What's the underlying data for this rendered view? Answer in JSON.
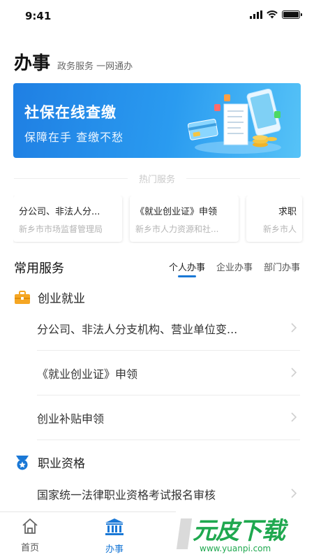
{
  "status_bar": {
    "time": "9:41"
  },
  "header": {
    "title": "办事",
    "subtitle": "政务服务 一网通办"
  },
  "banner": {
    "title": "社保在线查缴",
    "subtitle": "保障在手  查缴不愁"
  },
  "hot_services": {
    "heading": "热门服务",
    "cards": [
      {
        "title": "分公司、非法人分...",
        "dept": "新乡市市场监督管理局"
      },
      {
        "title": "《就业创业证》申领",
        "dept": "新乡市人力资源和社..."
      },
      {
        "title": "求职",
        "dept": "新乡市人"
      }
    ]
  },
  "common_services": {
    "title": "常用服务",
    "tabs": [
      {
        "label": "个人办事",
        "active": true
      },
      {
        "label": "企业办事",
        "active": false
      },
      {
        "label": "部门办事",
        "active": false
      }
    ],
    "groups": [
      {
        "title": "创业就业",
        "icon": "briefcase-icon",
        "items": [
          "分公司、非法人分支机构、营业单位变...",
          "《就业创业证》申领",
          "创业补贴申领"
        ]
      },
      {
        "title": "职业资格",
        "icon": "medal-icon",
        "items": [
          "国家统一法律职业资格考试报名审核"
        ]
      }
    ]
  },
  "tabbar": {
    "items": [
      {
        "label": "首页",
        "icon": "home-icon",
        "active": false
      },
      {
        "label": "办事",
        "icon": "bank-icon",
        "active": true
      }
    ]
  },
  "watermark": {
    "brand": "元皮下载",
    "url": "www.yuanpi.com"
  },
  "colors": {
    "accent": "#1a78d6",
    "banner_start": "#1f7fe3",
    "banner_end": "#56c3f7",
    "group_icon_orange": "#f5a623",
    "watermark_green": "#1fa84f"
  }
}
